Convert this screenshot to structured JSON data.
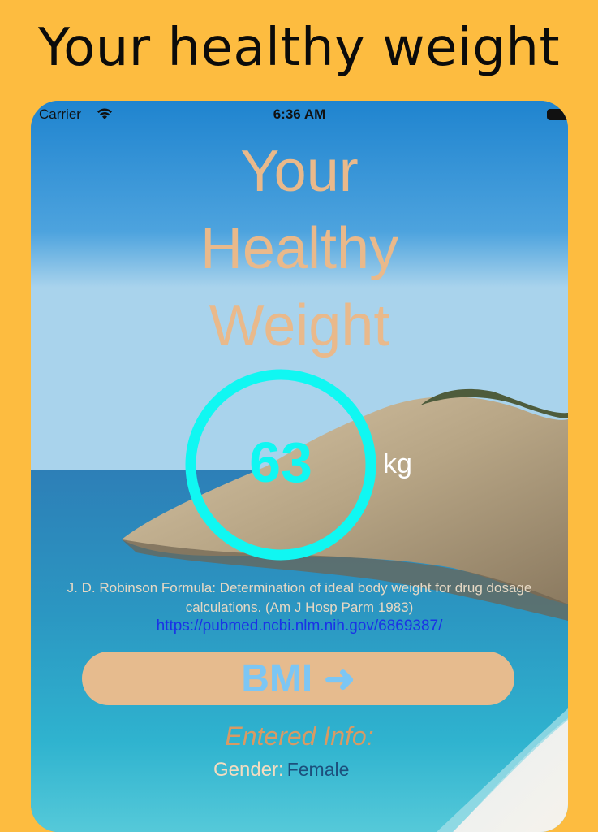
{
  "promo": {
    "headline": "Your healthy weight"
  },
  "status_bar": {
    "carrier": "Carrier",
    "time": "6:36 AM"
  },
  "app": {
    "title_lines": [
      "Your",
      "Healthy",
      "Weight"
    ],
    "weight_value": "63",
    "weight_unit": "kg",
    "formula_text": "J. D. Robinson Formula: Determination of ideal body weight for drug dosage calculations. (Am J Hosp Parm 1983)",
    "source_link": "https://pubmed.ncbi.nlm.nih.gov/6869387/",
    "bmi_button_label": "BMI",
    "entered_info_heading": "Entered Info:",
    "gender_label": "Gender:",
    "gender_value": "Female"
  },
  "icons": {
    "wifi": "wifi-icon",
    "battery": "battery-icon",
    "bmi_arrow": "arrow-right-icon"
  },
  "colors": {
    "background": "#FDBC40",
    "title": "#E9B98B",
    "ring": "#10F7F2",
    "button": "#E6BB8E",
    "button_text": "#7CC6F4",
    "link": "#1a32e6"
  }
}
